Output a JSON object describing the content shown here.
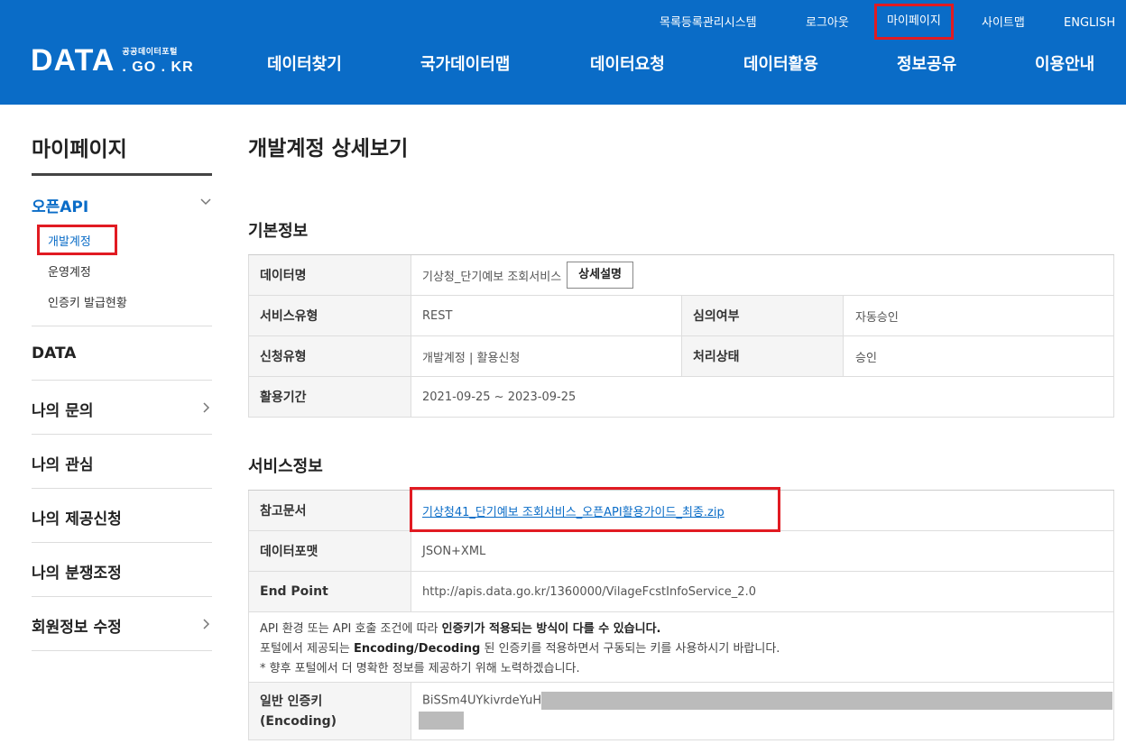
{
  "header": {
    "logo_main": "DATA",
    "logo_sub_top": "공공데이터포털",
    "logo_sub_bottom": ". GO . KR",
    "util_links": [
      "목록등록관리시스템",
      "로그아웃",
      "마이페이지",
      "사이트맵",
      "ENGLISH"
    ],
    "gnb": [
      "데이터찾기",
      "국가데이터맵",
      "데이터요청",
      "데이터활용",
      "정보공유",
      "이용안내"
    ]
  },
  "sidebar": {
    "title": "마이페이지",
    "open_section": "오픈API",
    "sub_items": [
      "개발계정",
      "운영계정",
      "인증키 발급현황"
    ],
    "items": [
      "DATA",
      "나의 문의",
      "나의 관심",
      "나의 제공신청",
      "나의 분쟁조정",
      "회원정보 수정"
    ]
  },
  "main": {
    "page_title": "개발계정 상세보기",
    "basic_info": {
      "title": "기본정보",
      "data_name_label": "데이터명",
      "data_name_value": "기상청_단기예보 조회서비스",
      "detail_button": "상세설명",
      "service_type_label": "서비스유형",
      "service_type_value": "REST",
      "review_label": "심의여부",
      "review_value": "자동승인",
      "request_type_label": "신청유형",
      "request_type_value": "개발계정 | 활용신청",
      "status_label": "처리상태",
      "status_value": "승인",
      "period_label": "활용기간",
      "period_value": "2021-09-25 ~ 2023-09-25"
    },
    "service_info": {
      "title": "서비스정보",
      "ref_doc_label": "참고문서",
      "ref_doc_value": "기상청41_단기예보 조회서비스_오픈API활용가이드_최종.zip",
      "format_label": "데이터포맷",
      "format_value": "JSON+XML",
      "endpoint_label": "End Point",
      "endpoint_value": "http://apis.data.go.kr/1360000/VilageFcstInfoService_2.0",
      "notice_1a": "API 환경 또는 API 호출 조건에 따라 ",
      "notice_1b": "인증키가 적용되는 방식이 다를 수 있습니다.",
      "notice_2a": "포털에서 제공되는 ",
      "notice_2b": "Encoding/Decoding",
      "notice_2c": " 된 인증키를 적용하면서 구동되는 키를 사용하시기 바랍니다.",
      "notice_3": "* 향후 포털에서 더 명확한 정보를 제공하기 위해 노력하겠습니다.",
      "key_label_1": "일반 인증키",
      "key_label_2": "(Encoding)",
      "key_value_visible": "BiSSm4UYkivrdeYuH"
    }
  }
}
